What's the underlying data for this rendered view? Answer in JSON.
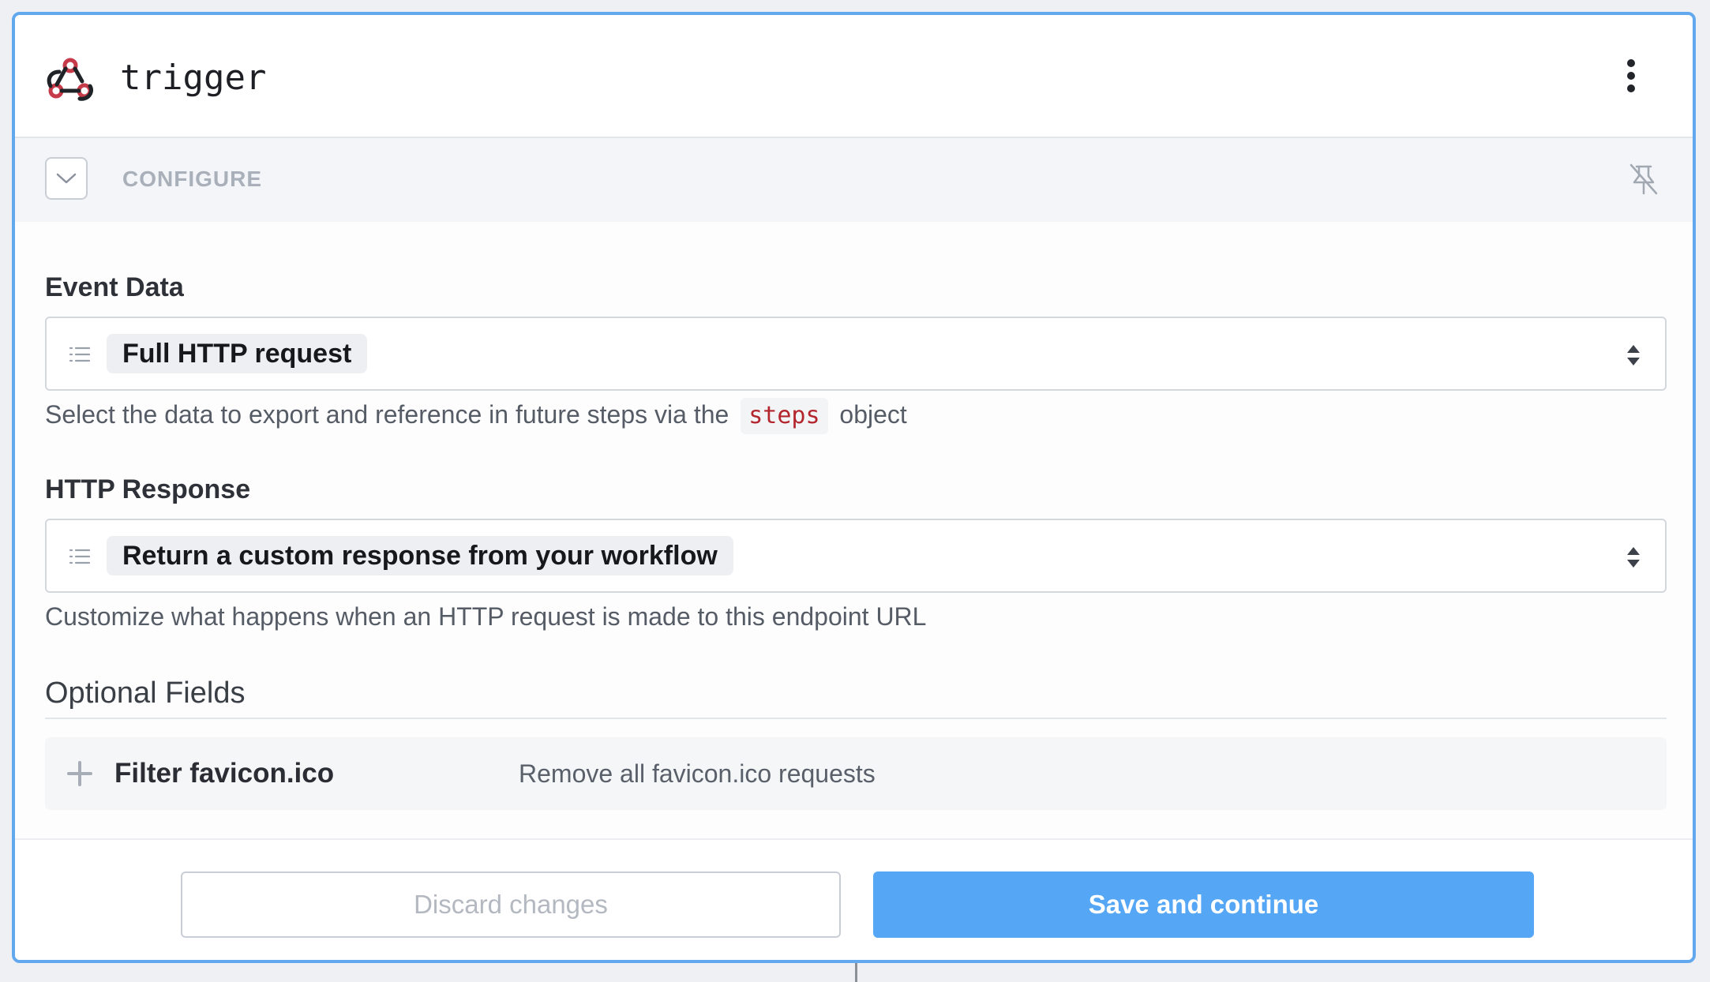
{
  "header": {
    "title": "trigger",
    "icon": "webhook-icon",
    "menu_icon": "more-vertical-icon"
  },
  "configure": {
    "label": "CONFIGURE",
    "collapse_icon": "chevron-down-icon",
    "pin_icon": "unpin-icon"
  },
  "event_data": {
    "label": "Event Data",
    "value": "Full HTTP request",
    "help_before": "Select the data to export and reference in future steps via the",
    "help_code": "steps",
    "help_after": "object"
  },
  "http_response": {
    "label": "HTTP Response",
    "value": "Return a custom response from your workflow",
    "help": "Customize what happens when an HTTP request is made to this endpoint URL"
  },
  "optional_fields": {
    "title": "Optional Fields",
    "items": [
      {
        "name": "Filter favicon.ico",
        "description": "Remove all favicon.ico requests"
      }
    ]
  },
  "footer": {
    "discard_label": "Discard changes",
    "save_label": "Save and continue"
  },
  "colors": {
    "accent": "#55a7f5",
    "card_border": "#62a8ee",
    "code_text": "#b3262d",
    "webhook_icon": "#c73a4a"
  }
}
